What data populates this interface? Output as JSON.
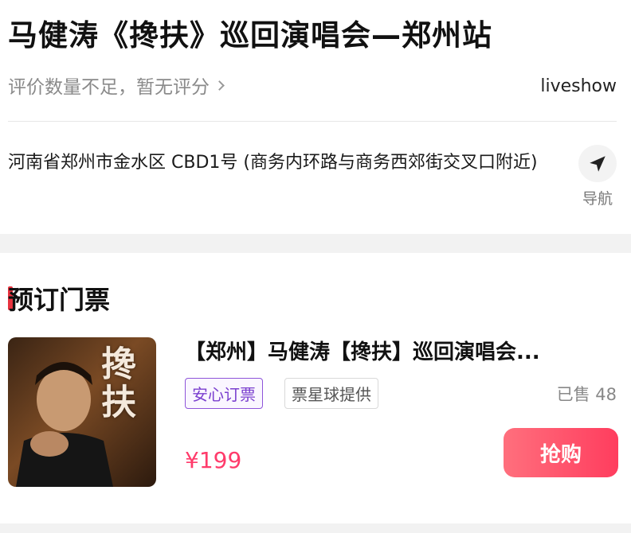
{
  "venue": {
    "title": "马健涛《搀扶》巡回演唱会—郑州站",
    "rating_text": "评价数量不足，暂无评分",
    "source": "liveshow",
    "address": "河南省郑州市金水区 CBD1号 (商务内环路与商务西郊街交叉口附近)",
    "nav_label": "导航"
  },
  "booking": {
    "section_title": "预订门票",
    "ticket": {
      "title": "【郑州】马健涛【搀扶】巡回演唱会...",
      "tag_primary": "安心订票",
      "tag_secondary": "票星球提供",
      "sold": "已售 48",
      "price": "¥199",
      "buy_label": "抢购",
      "poster_text": "搀扶"
    }
  },
  "icons": {
    "rating_chevron": "chevron-right-icon",
    "navigate": "navigation-arrow-icon"
  },
  "colors": {
    "accent": "#e8333f",
    "price": "#ff3b6b",
    "tag": "#8e54d9",
    "button": "#ff4f6a"
  }
}
